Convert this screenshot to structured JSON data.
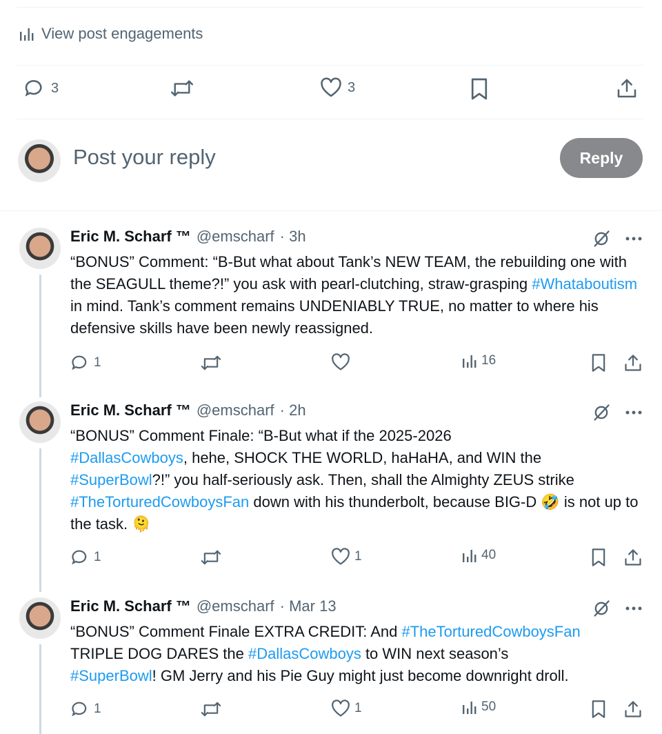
{
  "engagements_label": "View post engagements",
  "main_actions": {
    "reply_count": "3",
    "like_count": "3"
  },
  "reply_box": {
    "placeholder": "Post your reply",
    "button_label": "Reply"
  },
  "tweets": [
    {
      "name": "Eric M. Scharf ™",
      "handle": "@emscharf",
      "time": "· 3h",
      "body_parts": [
        {
          "t": "“BONUS” Comment: “B-But what about Tank’s NEW TEAM, the rebuilding one with the SEAGULL theme?!” you ask with pearl-clutching, straw-grasping "
        },
        {
          "t": "#Whataboutism",
          "tag": true
        },
        {
          "t": " in mind. Tank’s comment remains UNDENIABLY TRUE, no matter to where his defensive skills have been newly reassigned."
        }
      ],
      "replies": "1",
      "likes": "",
      "views": "16"
    },
    {
      "name": "Eric M. Scharf ™",
      "handle": "@emscharf",
      "time": "· 2h",
      "body_parts": [
        {
          "t": "“BONUS” Comment Finale: “B-But what if the 2025-2026\n"
        },
        {
          "t": "#DallasCowboys",
          "tag": true
        },
        {
          "t": ", hehe, SHOCK THE WORLD, haHaHA, and WIN the\n"
        },
        {
          "t": "#SuperBowl",
          "tag": true
        },
        {
          "t": "?!” you half-seriously ask. Then, shall the Almighty ZEUS strike\n"
        },
        {
          "t": "#TheTorturedCowboysFan",
          "tag": true
        },
        {
          "t": " down with his thunderbolt, because BIG-D 🤣 is not up to the task. 🫠"
        }
      ],
      "replies": "1",
      "likes": "1",
      "views": "40"
    },
    {
      "name": "Eric M. Scharf ™",
      "handle": "@emscharf",
      "time": "· Mar 13",
      "body_parts": [
        {
          "t": "“BONUS” Comment Finale EXTRA CREDIT: And "
        },
        {
          "t": "#TheTorturedCowboysFan",
          "tag": true
        },
        {
          "t": "\nTRIPLE DOG DARES the "
        },
        {
          "t": "#DallasCowboys",
          "tag": true
        },
        {
          "t": " to WIN next season’s\n"
        },
        {
          "t": "#SuperBowl",
          "tag": true
        },
        {
          "t": "! GM Jerry and his Pie Guy might just become downright droll."
        }
      ],
      "replies": "1",
      "likes": "1",
      "views": "50"
    }
  ]
}
